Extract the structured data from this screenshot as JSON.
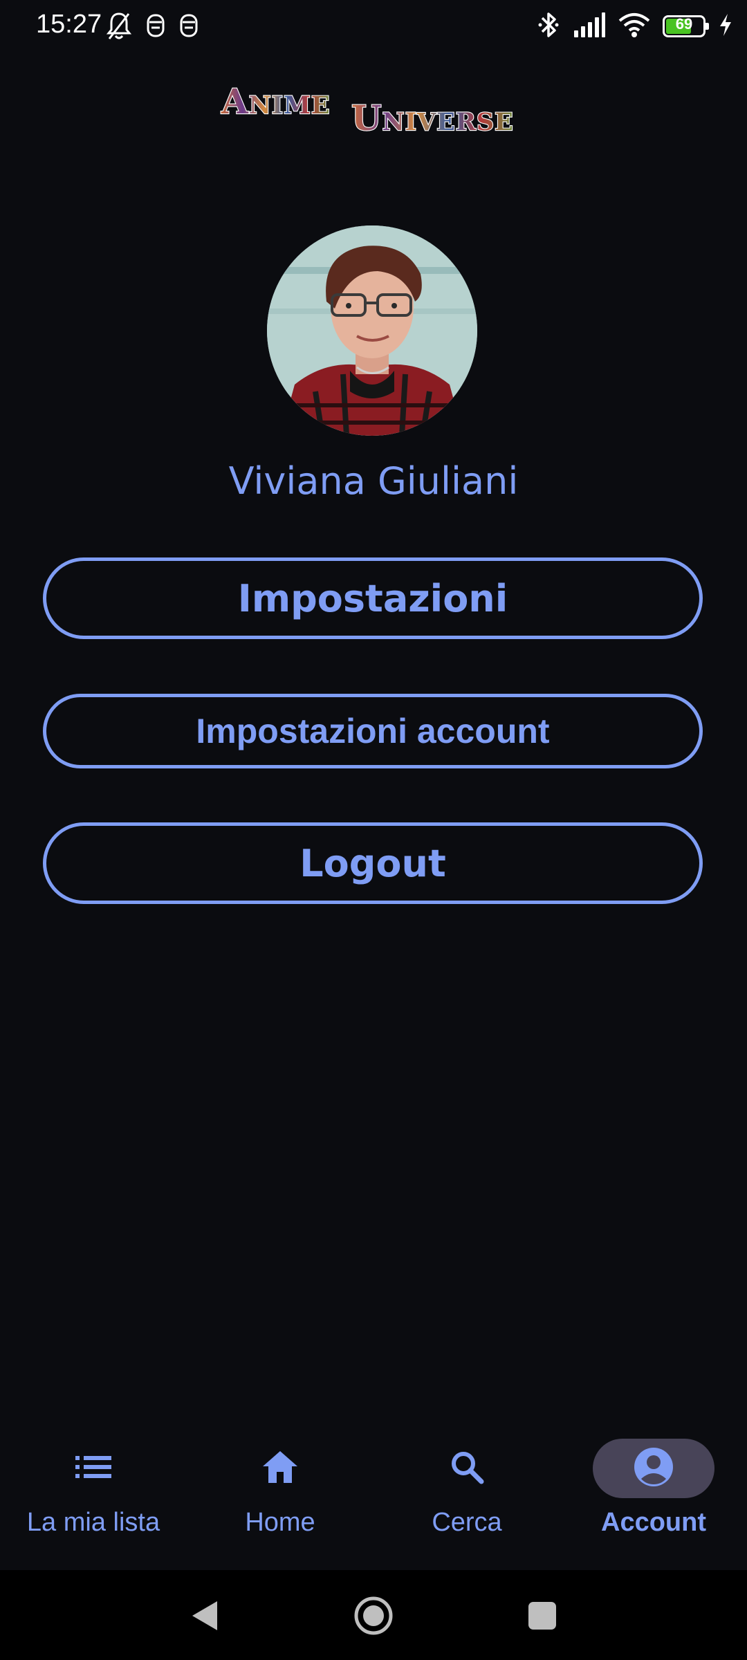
{
  "status_bar": {
    "time": "15:27",
    "battery_level": "69",
    "battery_fraction": 0.69,
    "left_icons": [
      "bell-off-icon",
      "notification-app-icon",
      "notification-app-icon"
    ],
    "right_icons": [
      "bluetooth-icon",
      "cellular-signal-icon",
      "wifi-icon",
      "battery-icon",
      "charging-icon"
    ]
  },
  "app": {
    "logo_text_part1": "Anime",
    "logo_text_part2": "Universe"
  },
  "profile": {
    "name": "Viviana Giuliani",
    "avatar_icon": "profile-photo"
  },
  "buttons": {
    "settings": "Impostazioni",
    "account_settings": "Impostazioni account",
    "logout": "Logout"
  },
  "bottom_nav": {
    "items": [
      {
        "label": "La mia lista",
        "icon": "list-icon",
        "active": false
      },
      {
        "label": "Home",
        "icon": "home-icon",
        "active": false
      },
      {
        "label": "Cerca",
        "icon": "search-icon",
        "active": false
      },
      {
        "label": "Account",
        "icon": "account-circle-icon",
        "active": true
      }
    ]
  },
  "system_nav": {
    "icons": [
      "back-icon",
      "home-circle-icon",
      "recents-icon"
    ]
  },
  "colors": {
    "background": "#0b0c10",
    "accent": "#7f9df4",
    "active_indicator": "#484458",
    "battery_fill": "#49c322"
  }
}
